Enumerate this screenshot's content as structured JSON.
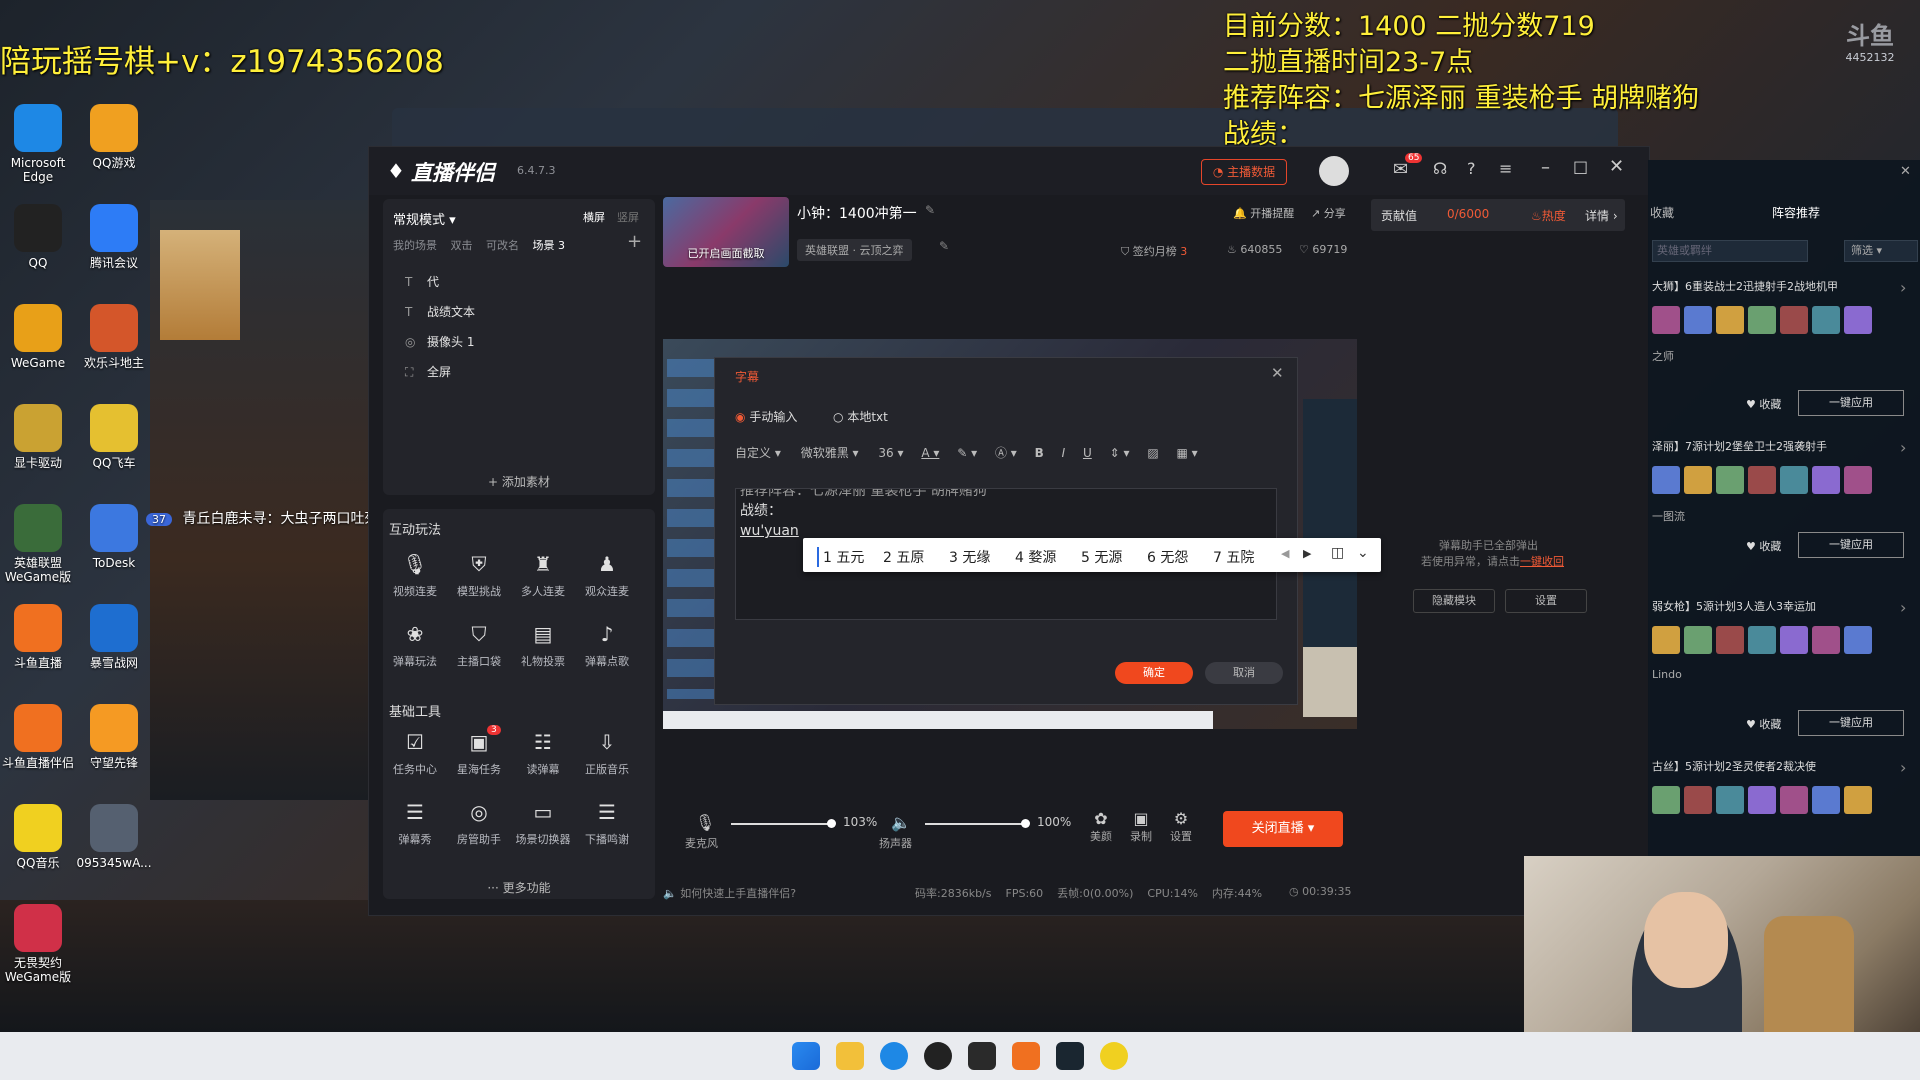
{
  "overlay": {
    "contact": "陪玩揺号棋+v：z1974356208",
    "score_line": "目前分数：1400 二抛分数719",
    "time_line": "二抛直播时间23-7点",
    "lineup_line": "推荐阵容：七源泽丽 重装枪手 胡牌赌狗",
    "record_line": "战绩：",
    "douyu_logo": "斗鱼",
    "room_id": "4452132"
  },
  "desktop_icons": [
    {
      "label": "Microsoft Edge",
      "color": "#1e88e5"
    },
    {
      "label": "QQ游戏",
      "color": "#f0a020"
    },
    {
      "label": "QQ",
      "color": "#222"
    },
    {
      "label": "腾讯会议",
      "color": "#2d7cf6"
    },
    {
      "label": "WeGame",
      "color": "#e8a018"
    },
    {
      "label": "欢乐斗地主",
      "color": "#d4562a"
    },
    {
      "label": "显卡驱动",
      "color": "#caa232"
    },
    {
      "label": "QQ飞车",
      "color": "#e5c030"
    },
    {
      "label": "英雄联盟 WeGame版",
      "color": "#3a6c3a"
    },
    {
      "label": "ToDesk",
      "color": "#3c78e0"
    },
    {
      "label": "斗鱼直播",
      "color": "#f07020"
    },
    {
      "label": "暴雪战网",
      "color": "#1e6ed0"
    },
    {
      "label": "斗鱼直播伴侣",
      "color": "#f07020"
    },
    {
      "label": "守望先锋",
      "color": "#f59a23"
    },
    {
      "label": "QQ音乐",
      "color": "#f0d020"
    },
    {
      "label": "095345wA...",
      "color": "#556070"
    },
    {
      "label": "无畏契约 WeGame版",
      "color": "#d03048"
    }
  ],
  "danmaku": {
    "badge": "37",
    "text": "青丘白鹿未寻：大虫子两口吐死"
  },
  "app": {
    "logo": "直播伴侣",
    "version": "6.4.7.3",
    "host_data": "主播数据",
    "mode": "常规模式",
    "landscape": "横屏",
    "portrait": "竖屏",
    "scene_tabs": [
      "我的场景",
      "双击",
      "可改名",
      "场景 3"
    ],
    "scene_items": [
      {
        "icon": "T",
        "label": "代"
      },
      {
        "icon": "T",
        "label": "战绩文本"
      },
      {
        "icon": "◎",
        "label": "摄像头 1"
      },
      {
        "icon": "⛶",
        "label": "全屏"
      }
    ],
    "add_material": "添加素材",
    "interactive_title": "互动玩法",
    "interactive": [
      "视频连麦",
      "模型挑战",
      "多人连麦",
      "观众连麦",
      "弹幕玩法",
      "主播口袋",
      "礼物投票",
      "弹幕点歌"
    ],
    "basic_title": "基础工具",
    "basic": [
      "任务中心",
      "星海任务",
      "读弹幕",
      "正版音乐",
      "弹幕秀",
      "房管助手",
      "场景切换器",
      "下播鸣谢"
    ],
    "basic_badge": "3",
    "more": "更多功能",
    "stream_title": "小钟：1400冲第一",
    "preview_label": "已开启画面截取",
    "category": "英雄联盟 · 云顶之弈",
    "notify": "开播提醒",
    "share": "分享",
    "sign": "签约月榜",
    "sign_num": "3",
    "fire": "640855",
    "likes": "69719",
    "contrib": "贡献值",
    "contrib_val": "0/6000",
    "hot": "热度",
    "detail": "详情",
    "mic_label": "麦克风",
    "mic_pct": "103%",
    "spk_label": "扬声器",
    "spk_pct": "100%",
    "beauty": "美颜",
    "record": "录制",
    "settings": "设置",
    "stop_live": "关闭直播",
    "help": "如何快速上手直播伴侣?",
    "stats": [
      "码率:2836kb/s",
      "FPS:60",
      "丢帧:0(0.00%)",
      "CPU:14%",
      "内存:44%"
    ],
    "duration": "00:39:35",
    "danmaku_assist_1": "弹幕助手已全部弹出",
    "danmaku_assist_2": "若使用异常，请点击",
    "danmaku_assist_link": "一键收回",
    "hide_module": "隐藏模块",
    "settings_btn": "设置",
    "msg_badge": "65"
  },
  "modal": {
    "title": "字幕",
    "radio_manual": "手动输入",
    "radio_txt": "本地txt",
    "style": "自定义",
    "font": "微软雅黑",
    "size": "36",
    "lines": [
      "推荐阵容：七源泽丽 重装枪手 胡牌赌狗",
      "战绩：",
      "wu'yuan"
    ],
    "ok": "确定",
    "cancel": "取消"
  },
  "ime": {
    "candidates": [
      "1 五元",
      "2 五原",
      "3 无缘",
      "4 婺源",
      "5 无源",
      "6 无怨",
      "7 五院"
    ]
  },
  "right_panel": {
    "tab_fav": "收藏",
    "tab_recommend": "阵容推荐",
    "search_placeholder": "英雄或羁绊",
    "filter": "筛选",
    "cards": [
      {
        "title": "大狮】6重装战士2迅捷射手2战地机甲",
        "sub": "之师",
        "fav": "收藏",
        "apply": "一键应用"
      },
      {
        "title": "泽丽】7源计划2堡垒卫士2强袭射手",
        "sub": "一图流",
        "fav": "收藏",
        "apply": "一键应用"
      },
      {
        "title": "弱女枪】5源计划3人造人3幸运加",
        "sub": "Lindo",
        "fav": "收藏",
        "apply": "一键应用"
      },
      {
        "title": "古丝】5源计划2圣灵使者2裁决使",
        "sub": "",
        "fav": "",
        "apply": ""
      }
    ]
  },
  "taskbar": {
    "icons": [
      "windows-start",
      "file-explorer",
      "edge",
      "qq",
      "wegame",
      "douyu",
      "league",
      "qq-music"
    ]
  }
}
